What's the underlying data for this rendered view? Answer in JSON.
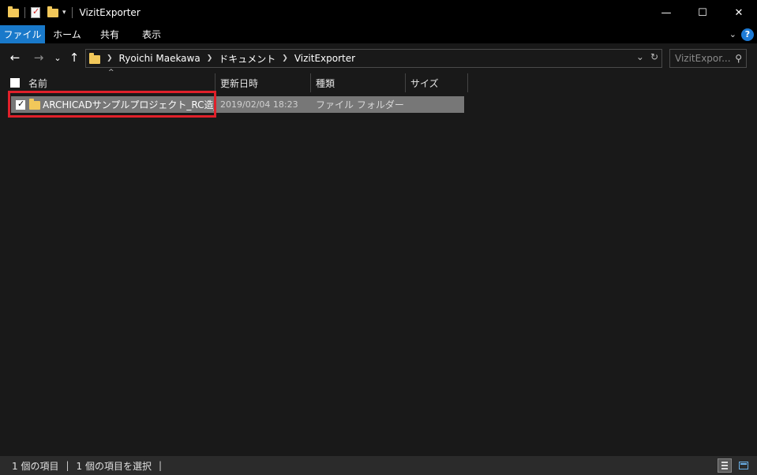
{
  "window": {
    "title": "VizitExporter",
    "minimize_glyph": "—",
    "maximize_glyph": "☐",
    "close_glyph": "✕"
  },
  "ribbon": {
    "tabs": [
      {
        "label": "ファイル"
      },
      {
        "label": "ホーム"
      },
      {
        "label": "共有"
      },
      {
        "label": "表示"
      }
    ],
    "help_glyph": "?",
    "expand_glyph": "⌄"
  },
  "nav": {
    "back_glyph": "←",
    "forward_glyph": "→",
    "recent_glyph": "⌄",
    "up_glyph": "↑"
  },
  "address": {
    "crumbs": [
      "Ryoichi Maekawa",
      "ドキュメント",
      "VizitExporter"
    ],
    "dropdown_glyph": "⌄",
    "refresh_glyph": "↻"
  },
  "search": {
    "placeholder": "VizitExpor...",
    "icon_glyph": "⚲"
  },
  "columns": [
    {
      "label": "名前"
    },
    {
      "label": "更新日時"
    },
    {
      "label": "種類"
    },
    {
      "label": "サイズ"
    }
  ],
  "sort_indicator": "^",
  "files": [
    {
      "name": "ARCHICADサンプルプロジェクト_RC造_集...",
      "modified": "2019/02/04 18:23",
      "type": "ファイル フォルダー",
      "size": ""
    }
  ],
  "status": {
    "item_count": "1 個の項目",
    "selected_count": "1 個の項目を選択",
    "divider": "|"
  },
  "colors": {
    "accent": "#1979ca",
    "selection_row": "#777777",
    "highlight_box": "#e0202a",
    "folder": "#f2c85a"
  }
}
